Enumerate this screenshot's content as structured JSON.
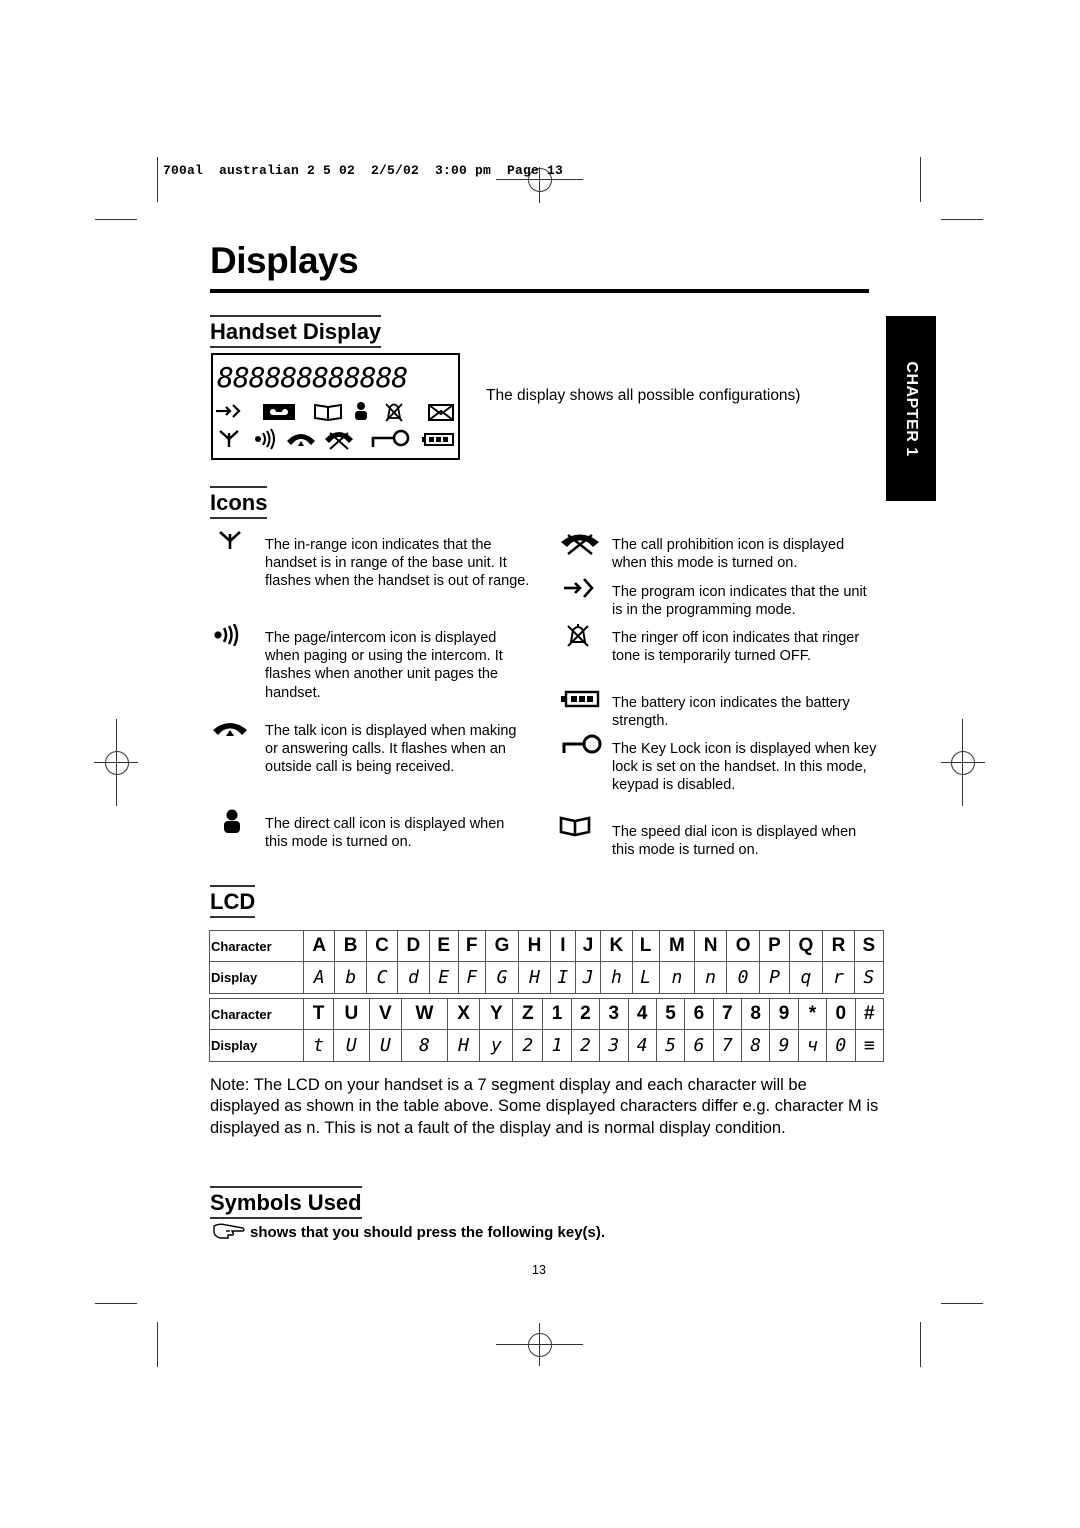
{
  "slug": "700al  australian 2 5 02  2/5/02  3:00 pm  Page 13",
  "title": "Displays",
  "chapter_tab": "CHAPTER 1",
  "handset_display": {
    "heading": "Handset Display",
    "segment_digits": "888888888888",
    "caption": "The display shows all possible configurations)"
  },
  "icons": {
    "heading": "Icons",
    "left": [
      {
        "icon": "in-range-antenna-icon",
        "glyph": "Ψ",
        "text": "The in-range icon indicates that the handset is in range of the base unit. It flashes when the handset is out of range."
      },
      {
        "icon": "page-intercom-icon",
        "glyph": "•)))",
        "text": "The page/intercom icon is displayed when paging or using the intercom. It flashes when another unit pages the handset."
      },
      {
        "icon": "talk-handset-icon",
        "glyph": "☎",
        "text": "The talk icon is displayed when making or answering calls. It flashes when an outside call is being received."
      },
      {
        "icon": "direct-call-person-icon",
        "glyph": "👤",
        "text": "The direct call icon is displayed when this mode is turned on."
      }
    ],
    "right": [
      {
        "icon": "call-prohibition-icon",
        "glyph": "☎",
        "text": "The call prohibition icon is displayed when this mode is turned on."
      },
      {
        "icon": "program-arrow-icon",
        "glyph": "→",
        "text": "The program icon indicates that the unit is in the programming mode."
      },
      {
        "icon": "ringer-off-bell-icon",
        "glyph": "🔕",
        "text": "The ringer off icon indicates that ringer tone is temporarily turned OFF."
      },
      {
        "icon": "battery-icon",
        "glyph": "▮▮▮",
        "text": "The battery icon indicates the battery strength."
      },
      {
        "icon": "key-lock-icon",
        "glyph": "⊸",
        "text": "The Key Lock icon is displayed when key lock is set on the handset. In this mode, keypad is disabled."
      },
      {
        "icon": "speed-dial-book-icon",
        "glyph": "📖",
        "text": "The speed dial icon is displayed when this mode is turned on."
      }
    ]
  },
  "lcd": {
    "heading": "LCD",
    "row_label_character": "Character",
    "row_label_display": "Display",
    "table1": {
      "characters": [
        "A",
        "B",
        "C",
        "D",
        "E",
        "F",
        "G",
        "H",
        "I",
        "J",
        "K",
        "L",
        "M",
        "N",
        "O",
        "P",
        "Q",
        "R",
        "S"
      ],
      "displays": [
        "A",
        "b",
        "C",
        "d",
        "E",
        "F",
        "G",
        "H",
        "I",
        "J",
        "h",
        "L",
        "n",
        "n",
        "0",
        "P",
        "q",
        "r",
        "S"
      ]
    },
    "table2": {
      "characters": [
        "T",
        "U",
        "V",
        "W",
        "X",
        "Y",
        "Z",
        "1",
        "2",
        "3",
        "4",
        "5",
        "6",
        "7",
        "8",
        "9",
        "*",
        "0",
        "#"
      ],
      "displays": [
        "t",
        "U",
        "U",
        "8",
        "H",
        "y",
        "2",
        "1",
        "2",
        "3",
        "4",
        "5",
        "6",
        "7",
        "8",
        "9",
        "ч",
        "0",
        "≡"
      ]
    },
    "note": "Note: The LCD on your handset is a 7 segment display and each character will be displayed as shown in the table above. Some displayed characters differ e.g. character M is displayed as n. This is not a fault of the display and is normal display condition."
  },
  "symbols_used": {
    "heading": "Symbols Used",
    "text": "shows that you should press the following key(s)."
  },
  "page_number": "13"
}
